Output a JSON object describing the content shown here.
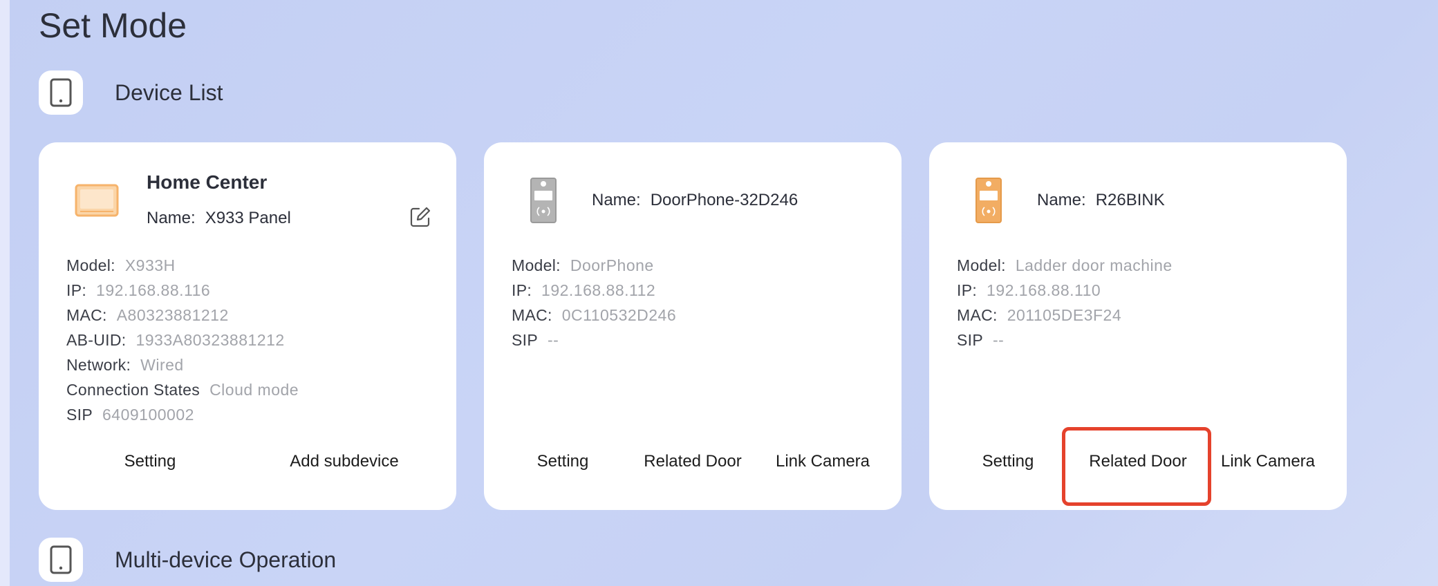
{
  "page": {
    "title": "Set Mode"
  },
  "sections": {
    "device_list": {
      "label": "Device List",
      "icon": "tablet-icon"
    },
    "multi_device": {
      "label": "Multi-device Operation",
      "icon": "tablet-icon"
    }
  },
  "cards": [
    {
      "title": "Home Center",
      "icon": "panel-icon",
      "name_key": "Name:",
      "name_value": "X933 Panel",
      "fields": [
        {
          "k": "Model:",
          "v": "X933H"
        },
        {
          "k": "IP:",
          "v": "192.168.88.116"
        },
        {
          "k": "MAC:",
          "v": "A80323881212"
        },
        {
          "k": "AB-UID:",
          "v": "1933A80323881212"
        },
        {
          "k": "Network:",
          "v": "Wired"
        },
        {
          "k": "Connection States",
          "v": "Cloud mode"
        },
        {
          "k": "SIP",
          "v": "6409100002"
        }
      ],
      "actions": [
        "Setting",
        "Add subdevice"
      ]
    },
    {
      "icon": "doorphone-gray-icon",
      "name_key": "Name:",
      "name_value": "DoorPhone-32D246",
      "fields": [
        {
          "k": "Model:",
          "v": "DoorPhone"
        },
        {
          "k": "IP:",
          "v": "192.168.88.112"
        },
        {
          "k": "MAC:",
          "v": "0C110532D246"
        },
        {
          "k": "SIP",
          "v": "--"
        }
      ],
      "actions": [
        "Setting",
        "Related Door",
        "Link Camera"
      ]
    },
    {
      "icon": "doorphone-orange-icon",
      "name_key": "Name:",
      "name_value": "R26BINK",
      "fields": [
        {
          "k": "Model:",
          "v": "Ladder door machine"
        },
        {
          "k": "IP:",
          "v": "192.168.88.110"
        },
        {
          "k": "MAC:",
          "v": "201105DE3F24"
        },
        {
          "k": "SIP",
          "v": "--"
        }
      ],
      "actions": [
        "Setting",
        "Related Door",
        "Link Camera"
      ]
    }
  ],
  "colors": {
    "highlight": "#e5422c",
    "panel_orange": "#f6b36b",
    "doorphone_gray": "#a8a8a8",
    "doorphone_orange": "#eea356"
  }
}
